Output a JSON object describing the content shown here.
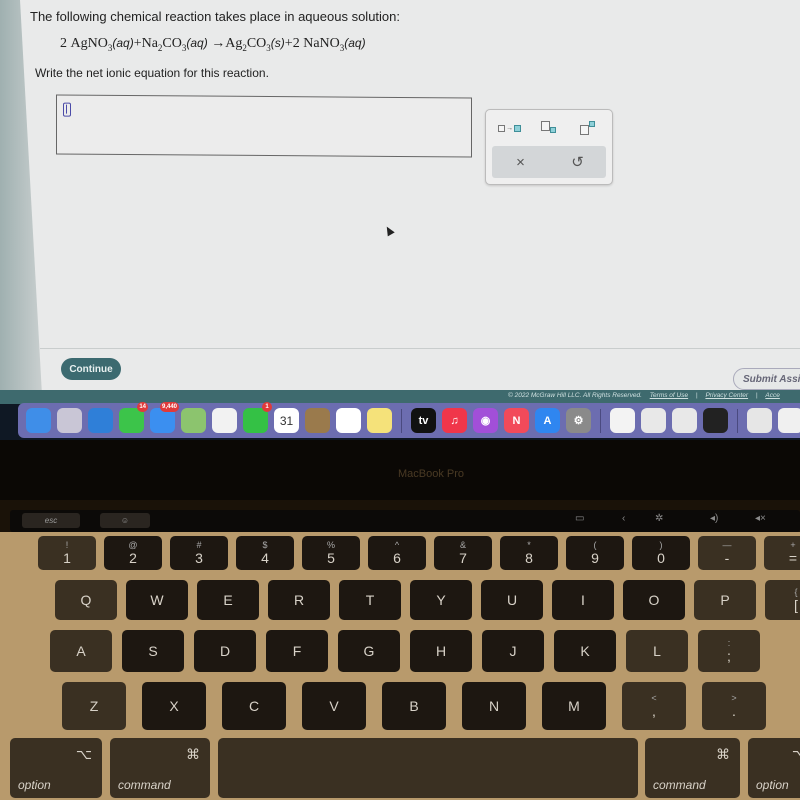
{
  "question": {
    "intro": "The following chemical reaction takes place in aqueous solution:",
    "equation": {
      "coef1": "2",
      "reactant1": "AgNO",
      "reactant1_sub": "3",
      "reactant1_state": "(aq)",
      "plus1": "+",
      "reactant2_a": "Na",
      "reactant2_sub_a": "2",
      "reactant2_b": "CO",
      "reactant2_sub_b": "3",
      "reactant2_state": "(aq)",
      "arrow": "→",
      "product1_a": "Ag",
      "product1_sub_a": "2",
      "product1_b": "CO",
      "product1_sub_b": "3",
      "product1_state": "(s)",
      "plus2": "+",
      "coef2": "2",
      "product2": "NaNO",
      "product2_sub": "3",
      "product2_state": "(aq)"
    },
    "prompt": "Write the net ionic equation for this reaction."
  },
  "answer": {
    "value": ""
  },
  "toolpad": {
    "tools": [
      "reaction-arrow",
      "subscript",
      "superscript"
    ],
    "clear_label": "×",
    "undo_label": "↺"
  },
  "buttons": {
    "continue": "Continue",
    "submit": "Submit Assig"
  },
  "footer": {
    "copyright": "© 2022 McGraw Hill LLC. All Rights Reserved.",
    "links": [
      "Terms of Use",
      "Privacy Center",
      "Acce"
    ],
    "separator": "|"
  },
  "dock": {
    "apps": [
      {
        "name": "finder",
        "label": "",
        "color": "#3f8ee8"
      },
      {
        "name": "launchpad",
        "label": "",
        "color": "#c9c6d6"
      },
      {
        "name": "safari",
        "label": "",
        "color": "#2f7fd8"
      },
      {
        "name": "messages",
        "label": "",
        "color": "#3cc44a",
        "badge": "14"
      },
      {
        "name": "mail",
        "label": "",
        "color": "#3b8ff0",
        "badge": "9,440"
      },
      {
        "name": "maps",
        "label": "",
        "color": "#8cc46e"
      },
      {
        "name": "photos",
        "label": "",
        "color": "#f2f2f2"
      },
      {
        "name": "facetime",
        "label": "",
        "color": "#34c145",
        "badge": "1"
      },
      {
        "name": "calendar",
        "label": "31",
        "color": "#ffffff"
      },
      {
        "name": "contacts",
        "label": "",
        "color": "#9a7a4c"
      },
      {
        "name": "reminders",
        "label": "",
        "color": "#ffffff"
      },
      {
        "name": "notes",
        "label": "",
        "color": "#f5e27a"
      },
      {
        "name": "apple-tv",
        "label": "tv",
        "color": "#111111"
      },
      {
        "name": "music",
        "label": "♫",
        "color": "#f0364a"
      },
      {
        "name": "podcasts",
        "label": "◉",
        "color": "#a24fd8"
      },
      {
        "name": "news",
        "label": "N",
        "color": "#f24a5a"
      },
      {
        "name": "app-store",
        "label": "A",
        "color": "#2f86f0"
      },
      {
        "name": "system-preferences",
        "label": "⚙",
        "color": "#8a8a8a"
      },
      {
        "name": "chrome",
        "label": "",
        "color": "#f3f3f3"
      },
      {
        "name": "preview-doc",
        "label": "",
        "color": "#e8e8e8"
      },
      {
        "name": "textedit",
        "label": "",
        "color": "#e8e8e8"
      },
      {
        "name": "printer",
        "label": "",
        "color": "#222222"
      },
      {
        "name": "document-1",
        "label": "",
        "color": "#e6e6e6"
      },
      {
        "name": "document-2",
        "label": "",
        "color": "#f0f0f0"
      },
      {
        "name": "document-3",
        "label": "",
        "color": "#f0f0f0"
      }
    ]
  },
  "laptop": {
    "brand": "MacBook Pro",
    "touchbar": {
      "esc": "esc"
    },
    "rows": [
      [
        {
          "main": "1",
          "top": "!"
        },
        {
          "main": "2",
          "top": "@"
        },
        {
          "main": "3",
          "top": "#"
        },
        {
          "main": "4",
          "top": "$"
        },
        {
          "main": "5",
          "top": "%"
        },
        {
          "main": "6",
          "top": "^"
        },
        {
          "main": "7",
          "top": "&"
        },
        {
          "main": "8",
          "top": "*"
        },
        {
          "main": "9",
          "top": "("
        },
        {
          "main": "0",
          "top": ")"
        },
        {
          "main": "-",
          "top": "—"
        },
        {
          "main": "=",
          "top": "+"
        }
      ],
      [
        {
          "main": "Q"
        },
        {
          "main": "W"
        },
        {
          "main": "E"
        },
        {
          "main": "R"
        },
        {
          "main": "T"
        },
        {
          "main": "Y"
        },
        {
          "main": "U"
        },
        {
          "main": "I"
        },
        {
          "main": "O"
        },
        {
          "main": "P"
        },
        {
          "main": "[",
          "top": "{"
        }
      ],
      [
        {
          "main": "A"
        },
        {
          "main": "S"
        },
        {
          "main": "D"
        },
        {
          "main": "F"
        },
        {
          "main": "G"
        },
        {
          "main": "H"
        },
        {
          "main": "J"
        },
        {
          "main": "K"
        },
        {
          "main": "L"
        },
        {
          "main": ";",
          "top": ":"
        }
      ],
      [
        {
          "main": "Z"
        },
        {
          "main": "X"
        },
        {
          "main": "C"
        },
        {
          "main": "V"
        },
        {
          "main": "B"
        },
        {
          "main": "N"
        },
        {
          "main": "M"
        },
        {
          "main": ",",
          "top": "<"
        },
        {
          "main": ".",
          "top": ">"
        }
      ]
    ],
    "modifiers": {
      "option_label": "option",
      "option_symbol": "⌥",
      "command_label": "command",
      "command_symbol": "⌘"
    }
  }
}
